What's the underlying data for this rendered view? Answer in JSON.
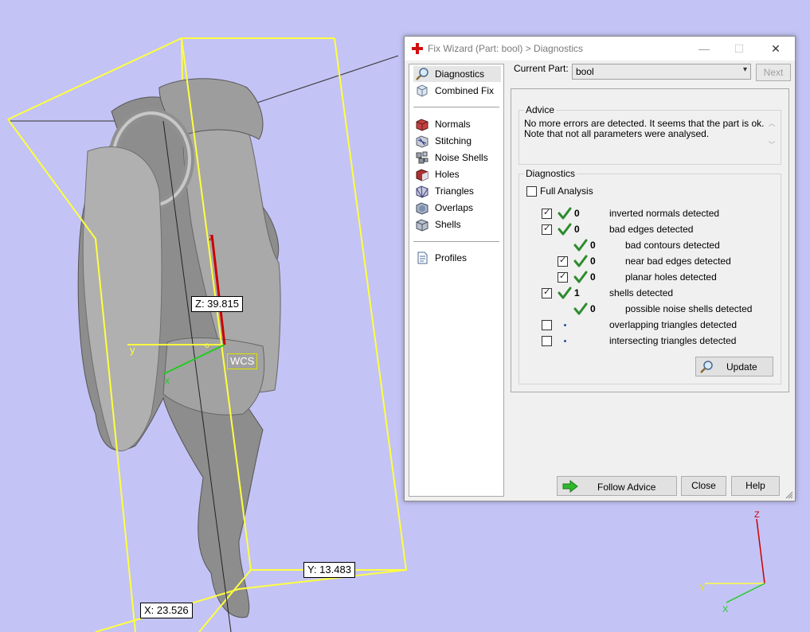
{
  "viewport": {
    "dim_z": "Z: 39.815",
    "dim_y": "Y: 13.483",
    "dim_x": "X: 23.526",
    "wcs_label": "WCS",
    "axis_y_label": "y",
    "axis_x_label": "x",
    "axis_z_label": "z",
    "origin_label": "o",
    "triad_labels": [
      "Z",
      "Y",
      "X"
    ],
    "colors": {
      "background": "#c3c3f5",
      "bounding_box": "#ffff40",
      "axis_x": "#22cc22",
      "axis_y": "#e8e800",
      "axis_z": "#cc0000"
    }
  },
  "window": {
    "title": "Fix Wizard (Part: bool) > Diagnostics",
    "title_icon": "red-cross-icon",
    "minimize": "—",
    "maximize": "☐",
    "close": "✕"
  },
  "sidebar": {
    "groups": [
      [
        {
          "label": "Diagnostics",
          "icon": "magnifier-icon",
          "selected": true
        },
        {
          "label": "Combined Fix",
          "icon": "cube-icon"
        }
      ],
      [
        {
          "label": "Normals",
          "icon": "normals-icon"
        },
        {
          "label": "Stitching",
          "icon": "stitching-icon"
        },
        {
          "label": "Noise Shells",
          "icon": "noise-shells-icon"
        },
        {
          "label": "Holes",
          "icon": "holes-icon"
        },
        {
          "label": "Triangles",
          "icon": "triangles-icon"
        },
        {
          "label": "Overlaps",
          "icon": "overlaps-icon"
        },
        {
          "label": "Shells",
          "icon": "shells-icon"
        }
      ],
      [
        {
          "label": "Profiles",
          "icon": "document-icon"
        }
      ]
    ]
  },
  "current_part": {
    "label": "Current Part:",
    "value": "bool",
    "next_label": "Next"
  },
  "advice": {
    "title": "Advice",
    "line1": "No more errors are detected. It seems that the part is ok.",
    "line2": "Note that not all parameters were analysed."
  },
  "diagnostics": {
    "title": "Diagnostics",
    "full_analysis_label": "Full Analysis",
    "full_analysis_checked": false,
    "rows": [
      {
        "checkbox": true,
        "checked": true,
        "status": "check",
        "count": "0",
        "label": "inverted normals detected",
        "indent": 0
      },
      {
        "checkbox": true,
        "checked": true,
        "status": "check",
        "count": "0",
        "label": "bad edges detected",
        "indent": 0
      },
      {
        "checkbox": false,
        "checked": false,
        "status": "check",
        "count": "0",
        "label": "bad contours detected",
        "indent": 1
      },
      {
        "checkbox": true,
        "checked": true,
        "status": "check",
        "count": "0",
        "label": "near bad edges detected",
        "indent": 1
      },
      {
        "checkbox": true,
        "checked": true,
        "status": "check",
        "count": "0",
        "label": "planar holes detected",
        "indent": 1
      },
      {
        "checkbox": true,
        "checked": true,
        "status": "check",
        "count": "1",
        "label": "shells detected",
        "indent": 0
      },
      {
        "checkbox": false,
        "checked": false,
        "status": "check",
        "count": "0",
        "label": "possible noise shells detected",
        "indent": 1
      },
      {
        "checkbox": true,
        "checked": false,
        "status": "dot",
        "count": "",
        "label": "overlapping triangles detected",
        "indent": 0
      },
      {
        "checkbox": true,
        "checked": false,
        "status": "dot",
        "count": "",
        "label": "intersecting triangles detected",
        "indent": 0
      }
    ],
    "update_label": "Update"
  },
  "footer": {
    "follow_advice_label": "Follow Advice",
    "close_label": "Close",
    "help_label": "Help"
  }
}
